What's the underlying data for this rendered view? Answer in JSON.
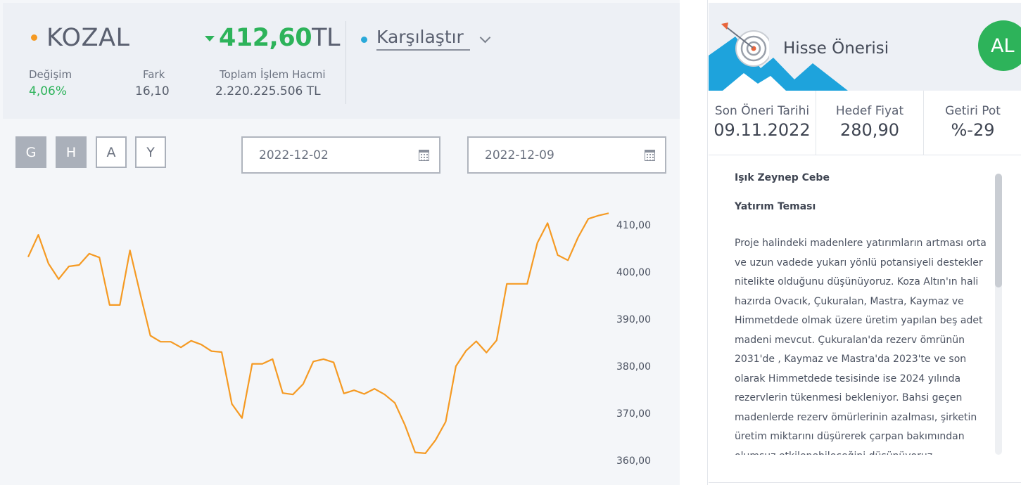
{
  "stock": {
    "symbol": "KOZAL",
    "price": "412,60",
    "currency": "TL",
    "change_label": "Değişim",
    "change_value": "4,06%",
    "diff_label": "Fark",
    "diff_value": "16,10",
    "volume_label": "Toplam İşlem Hacmi",
    "volume_value": "2.220.225.506 TL",
    "compare_label": "Karşılaştır",
    "colors": {
      "accent_dot": "#f59a23",
      "positive": "#2db35a",
      "compare_dot": "#2aa9d9"
    }
  },
  "range_buttons": [
    {
      "label": "G",
      "active": true
    },
    {
      "label": "H",
      "active": true
    },
    {
      "label": "A",
      "active": false
    },
    {
      "label": "Y",
      "active": false
    }
  ],
  "dates": {
    "start": "2022-12-02",
    "end": "2022-12-09",
    "icon": "calendar-icon"
  },
  "chart_data": {
    "type": "line",
    "color": "#f59a23",
    "y_ticks": [
      "410,00",
      "400,00",
      "390,00",
      "380,00",
      "370,00",
      "360,00"
    ],
    "ylim": [
      358.5,
      411.5
    ],
    "grid": false,
    "axis_position": "right",
    "series": [
      {
        "values": [
          403.2,
          407.9,
          401.8,
          398.5,
          401.2,
          401.5,
          403.9,
          403.1,
          393.0,
          393.0,
          404.6,
          395.4,
          386.5,
          385.2,
          385.2,
          384.0,
          385.4,
          384.6,
          383.2,
          383.0,
          372.0,
          369.0,
          380.5,
          380.5,
          381.5,
          374.3,
          374.0,
          376.2,
          381.0,
          381.5,
          380.8,
          374.2,
          374.9,
          374.1,
          375.2,
          374.0,
          372.2,
          367.5,
          361.7,
          361.5,
          364.3,
          368.2,
          380.0,
          383.3,
          385.3,
          382.9,
          385.5,
          397.5,
          397.5,
          397.5,
          406.2,
          410.4,
          403.6,
          402.5,
          407.4,
          411.3,
          412.0,
          412.5
        ]
      }
    ]
  },
  "recommendation": {
    "title": "Hisse Önerisi",
    "badge": "AL",
    "badge_color": "#2db35a",
    "stats": [
      {
        "label": "Son Öneri Tarihi",
        "value": "09.11.2022"
      },
      {
        "label": "Hedef Fiyat",
        "value": "280,90"
      },
      {
        "label": "Getiri Pot",
        "value": "%-29"
      }
    ],
    "author": "Işık Zeynep Cebe",
    "theme_label": "Yatırım Teması",
    "body": "Proje halindeki madenlere yatırımların artması orta ve uzun vadede yukarı yönlü potansiyeli destekler nitelikte olduğunu düşünüyoruz. Koza Altın'ın hali hazırda Ovacık, Çukuralan, Mastra, Kaymaz ve Himmetdede olmak üzere üretim yapılan beş adet madeni mevcut. Çukuralan'da rezerv ömrünün 2031'de , Kaymaz ve Mastra'da 2023'te ve son olarak Himmetdede tesisinde ise 2024 yılında rezervlerin tükenmesi bekleniyor. Bahsi geçen madenlerde rezerv ömürlerinin azalması, şirketin üretim miktarını düşürerek çarpan bakımından olumsuz etkilenebileceğini düşünüyoruz."
  }
}
